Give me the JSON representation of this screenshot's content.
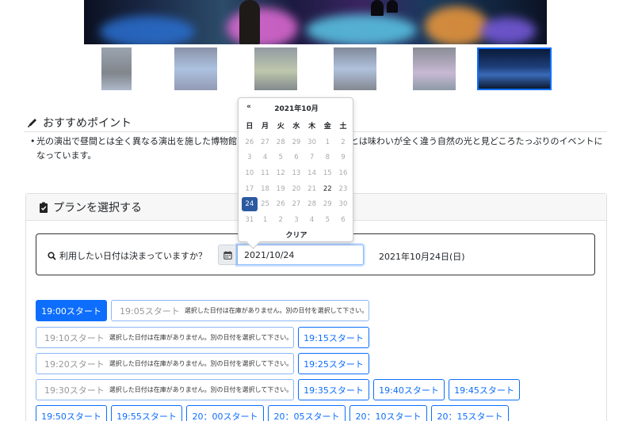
{
  "recommend": {
    "title": "おすすめポイント",
    "text": "光の演出で昼間とは全く異なる演出を施した博物館をイトギャラリー、人口の光とは味わいが全く違う自然の光と見どころたっぷりのイベントになっています。"
  },
  "plan": {
    "title": "プランを選択する",
    "question": "利用したい日付は決まっていますか？",
    "date_value": "2021/10/24",
    "date_selected": "2021年10月24日(日)"
  },
  "datepicker": {
    "prev": "«",
    "month": "2021年10月",
    "weekdays": [
      "日",
      "月",
      "火",
      "水",
      "木",
      "金",
      "土"
    ],
    "weeks": [
      [
        "26",
        "27",
        "28",
        "29",
        "30",
        "1",
        "2"
      ],
      [
        "3",
        "4",
        "5",
        "6",
        "7",
        "8",
        "9"
      ],
      [
        "10",
        "11",
        "12",
        "13",
        "14",
        "15",
        "16"
      ],
      [
        "17",
        "18",
        "19",
        "20",
        "21",
        "22",
        "23"
      ],
      [
        "24",
        "25",
        "26",
        "27",
        "28",
        "29",
        "30"
      ],
      [
        "31",
        "1",
        "2",
        "3",
        "4",
        "5",
        "6"
      ]
    ],
    "available": [
      "22"
    ],
    "selected": "24",
    "clear": "クリア"
  },
  "slots": {
    "unavailable_note": "選択した日付は在庫がありません。別の日付を選択して下さい。",
    "s1900": "19:00スタート",
    "s1905": "19:05スタート",
    "s1910": "19:10スタート",
    "s1915": "19:15スタート",
    "s1920": "19:20スタート",
    "s1925": "19:25スタート",
    "s1930": "19:30スタート",
    "s1935": "19:35スタート",
    "s1940": "19:40スタート",
    "s1945": "19:45スタート",
    "s1950": "19:50スタート",
    "s1955": "19:55スタート",
    "s2000": "20：00スタート",
    "s2005": "20：05スタート",
    "s2010": "20：10スタート",
    "s2015": "20：15スタート"
  },
  "colors": {
    "primary": "#0d6efd",
    "selected_day": "#2c5aa0"
  },
  "icons": {
    "pen": "pencil-icon",
    "check": "clipboard-check-icon",
    "search": "search-icon",
    "calendar": "calendar-icon"
  }
}
